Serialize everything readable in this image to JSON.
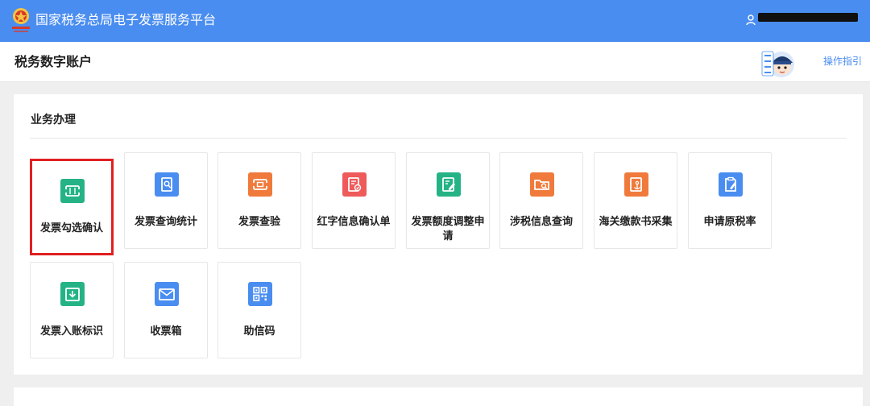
{
  "header": {
    "app_title": "国家税务总局电子发票服务平台",
    "user_name_redacted": true,
    "brand_color": "#4a8df0"
  },
  "subheader": {
    "page_title": "税务数字账户",
    "guide_link": "操作指引"
  },
  "section": {
    "title": "业务办理",
    "tiles": [
      {
        "label": "发票勾选确认",
        "icon": "invoice-ticket-icon",
        "color": "#25b386",
        "selected": true
      },
      {
        "label": "发票查询统计",
        "icon": "document-search-icon",
        "color": "#4a8df0"
      },
      {
        "label": "发票查验",
        "icon": "ticket-check-icon",
        "color": "#f07a3b"
      },
      {
        "label": "红字信息确认单",
        "icon": "document-check-icon",
        "color": "#ef5a5a"
      },
      {
        "label": "发票额度调整申请",
        "icon": "document-edit-icon",
        "color": "#25b386"
      },
      {
        "label": "涉税信息查询",
        "icon": "folder-search-icon",
        "color": "#f07a3b"
      },
      {
        "label": "海关缴款书采集",
        "icon": "document-anchor-icon",
        "color": "#f07a3b"
      },
      {
        "label": "申请原税率",
        "icon": "clipboard-edit-icon",
        "color": "#4a8df0"
      },
      {
        "label": "发票入账标识",
        "icon": "inbox-download-icon",
        "color": "#25b386"
      },
      {
        "label": "收票箱",
        "icon": "mail-icon",
        "color": "#4a8df0"
      },
      {
        "label": "助信码",
        "icon": "qr-code-icon",
        "color": "#4a8df0"
      }
    ]
  }
}
